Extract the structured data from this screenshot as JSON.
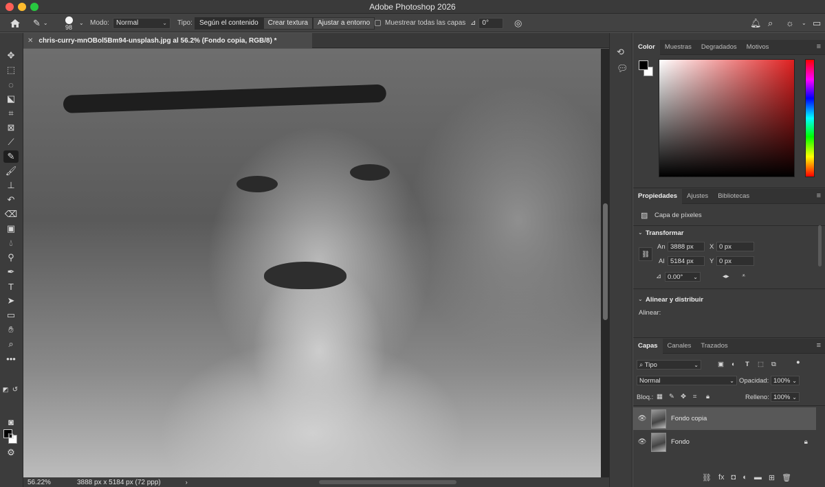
{
  "window": {
    "title": "Adobe Photoshop 2026"
  },
  "options_bar": {
    "brush_size": "98",
    "mode_label": "Modo:",
    "mode_value": "Normal",
    "type_label": "Tipo:",
    "type_options": [
      "Según el contenido",
      "Crear textura",
      "Ajustar a entorno"
    ],
    "sample_all_label": "Muestrear todas las capas",
    "angle_value": "0°"
  },
  "document": {
    "tab_title": "chris-curry-mnOBol5Bm94-unsplash.jpg al 56.2% (Fondo copia, RGB/8) *",
    "zoom": "56.22%",
    "dimensions": "3888 px x 5184 px (72 ppp)"
  },
  "color_panel": {
    "tabs": [
      "Color",
      "Muestras",
      "Degradados",
      "Motivos"
    ]
  },
  "properties_panel": {
    "tabs": [
      "Propiedades",
      "Ajustes",
      "Bibliotecas"
    ],
    "layer_type": "Capa de píxeles",
    "transform_title": "Transformar",
    "width_label": "An",
    "width_value": "3888 px",
    "height_label": "Al",
    "height_value": "5184 px",
    "x_label": "X",
    "x_value": "0 px",
    "y_label": "Y",
    "y_value": "0 px",
    "angle_value": "0.00°",
    "align_title": "Alinear y distribuir",
    "align_label": "Alinear:"
  },
  "layers_panel": {
    "tabs": [
      "Capas",
      "Canales",
      "Trazados"
    ],
    "filter_label": "Tipo",
    "blend_mode": "Normal",
    "opacity_label": "Opacidad:",
    "opacity_value": "100%",
    "lock_label": "Bloq.:",
    "fill_label": "Relleno:",
    "fill_value": "100%",
    "layers": [
      {
        "name": "Fondo copia",
        "active": true
      },
      {
        "name": "Fondo",
        "active": false,
        "locked": true
      }
    ]
  }
}
